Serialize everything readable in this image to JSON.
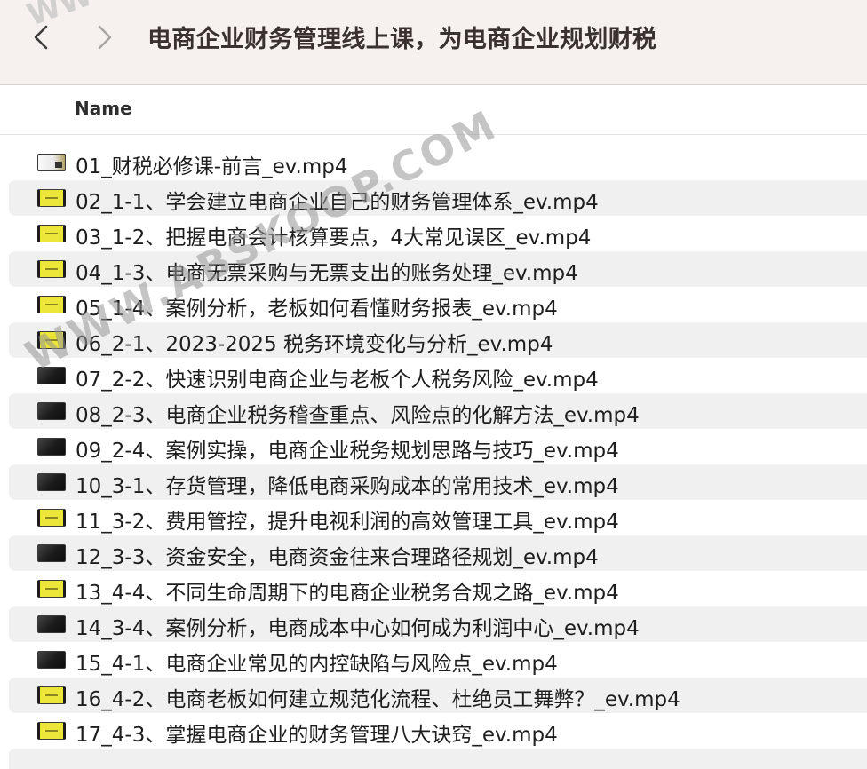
{
  "window": {
    "title": "电商企业财务管理线上课，为电商企业规划财税"
  },
  "toolbar": {
    "back_icon": "chevron-left-icon",
    "forward_icon": "chevron-right-icon"
  },
  "header": {
    "name_column": "Name"
  },
  "files": [
    {
      "name": "01_财税必修课-前言_ev.mp4",
      "thumb": "light"
    },
    {
      "name": "02_1-1、学会建立电商企业自己的财务管理体系_ev.mp4",
      "thumb": "yellow"
    },
    {
      "name": "03_1-2、把握电商会计核算要点，4大常见误区_ev.mp4",
      "thumb": "yellow"
    },
    {
      "name": "04_1-3、电商无票采购与无票支出的账务处理_ev.mp4",
      "thumb": "yellow"
    },
    {
      "name": "05_1-4、案例分析，老板如何看懂财务报表_ev.mp4",
      "thumb": "yellow"
    },
    {
      "name": "06_2-1、2023-2025 税务环境变化与分析_ev.mp4",
      "thumb": "yellow"
    },
    {
      "name": "07_2-2、快速识别电商企业与老板个人税务风险_ev.mp4",
      "thumb": "dark"
    },
    {
      "name": "08_2-3、电商企业税务稽查重点、风险点的化解方法_ev.mp4",
      "thumb": "dark"
    },
    {
      "name": "09_2-4、案例实操，电商企业税务规划思路与技巧_ev.mp4",
      "thumb": "dark"
    },
    {
      "name": "10_3-1、存货管理，降低电商采购成本的常用技术_ev.mp4",
      "thumb": "dark"
    },
    {
      "name": "11_3-2、费用管控，提升电视利润的高效管理工具_ev.mp4",
      "thumb": "yellow"
    },
    {
      "name": "12_3-3、资金安全，电商资金往来合理路径规划_ev.mp4",
      "thumb": "dark"
    },
    {
      "name": "13_4-4、不同生命周期下的电商企业税务合规之路_ev.mp4",
      "thumb": "yellow"
    },
    {
      "name": "14_3-4、案例分析，电商成本中心如何成为利润中心_ev.mp4",
      "thumb": "dark"
    },
    {
      "name": "15_4-1、电商企业常见的内控缺陷与风险点_ev.mp4",
      "thumb": "dark"
    },
    {
      "name": "16_4-2、电商老板如何建立规范化流程、杜绝员工舞弊？_ev.mp4",
      "thumb": "yellow"
    },
    {
      "name": "17_4-3、掌握电商企业的财务管理八大诀窍_ev.mp4",
      "thumb": "yellow"
    }
  ],
  "watermark": {
    "text": "WWW.ABSKOOP.COM",
    "top_text": "WW"
  },
  "colors": {
    "toolbar_bg": "#f6f1ee",
    "row_alt_bg": "#f0f0f0",
    "thumb_yellow": "#ece53a",
    "text": "#1e1e1e"
  }
}
